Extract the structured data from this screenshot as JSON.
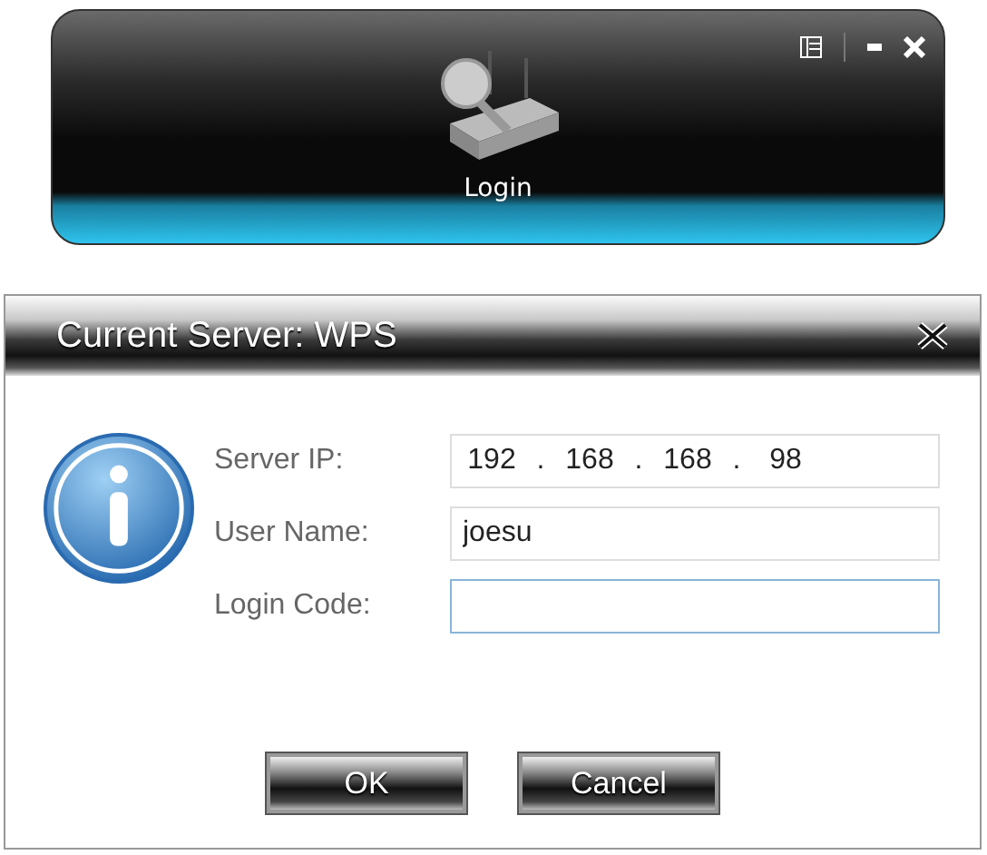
{
  "launcher": {
    "label": "Login",
    "selected": true
  },
  "dialog": {
    "title": "Current Server: WPS",
    "fields": [
      {
        "kind": "ip",
        "label": "Server IP:",
        "octets": [
          "192",
          "168",
          "168",
          "98"
        ],
        "separator": ".",
        "focused": false
      },
      {
        "kind": "text",
        "label": "User Name:",
        "value": "joesu",
        "focused": false
      },
      {
        "kind": "text",
        "label": "Login Code:",
        "focused": true
      }
    ],
    "buttons": [
      "OK",
      "Cancel"
    ]
  }
}
